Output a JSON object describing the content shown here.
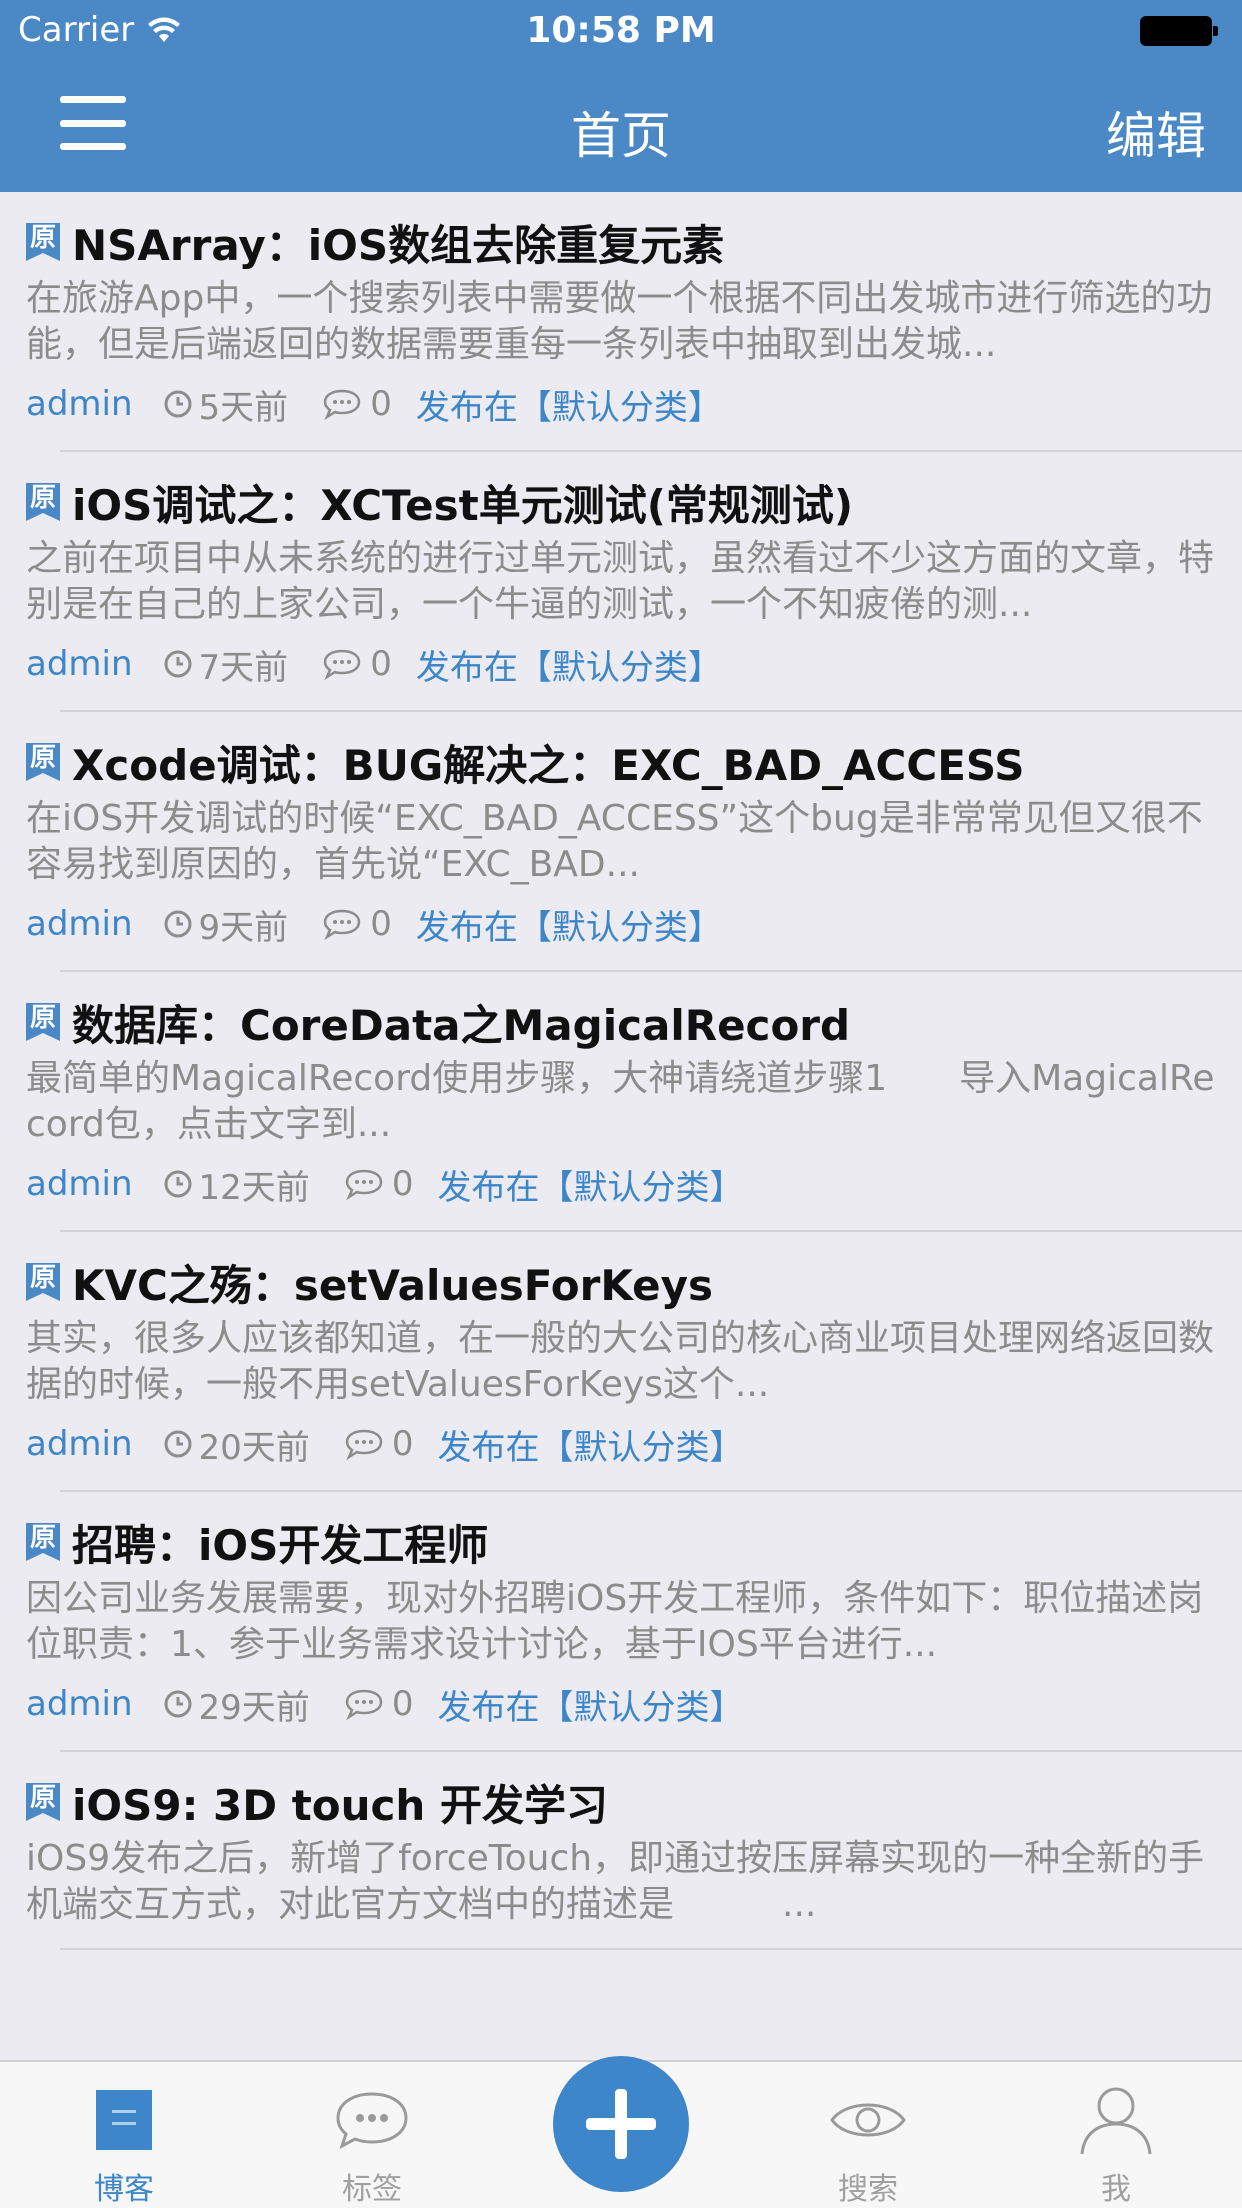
{
  "status_bar": {
    "carrier": "Carrier",
    "time": "10:58 PM"
  },
  "nav": {
    "title": "首页",
    "edit_label": "编辑"
  },
  "colors": {
    "nav_background": "#4a89c5",
    "accent": "#3d86c9",
    "background": "#ebebf1",
    "summary_text": "#8c8c8c"
  },
  "posts": [
    {
      "badge": "原",
      "title": "NSArray：iOS数组去除重复元素",
      "summary": "在旅游App中，一个搜索列表中需要做一个根据不同出发城市进行筛选的功能，但是后端返回的数据需要重每一条列表中抽取到出发城...",
      "author": "admin",
      "time": "5天前",
      "comments": "0",
      "category": "发布在【默认分类】"
    },
    {
      "badge": "原",
      "title": "iOS调试之：XCTest单元测试(常规测试)",
      "summary": "之前在项目中从未系统的进行过单元测试，虽然看过不少这方面的文章，特别是在自己的上家公司，一个牛逼的测试，一个不知疲倦的测...",
      "author": "admin",
      "time": "7天前",
      "comments": "0",
      "category": "发布在【默认分类】"
    },
    {
      "badge": "原",
      "title": "Xcode调试：BUG解决之：EXC_BAD_ACCESS",
      "summary": "在iOS开发调试的时候“EXC_BAD_ACCESS”这个bug是非常常见但又很不容易找到原因的，首先说“EXC_BAD...",
      "author": "admin",
      "time": "9天前",
      "comments": "0",
      "category": "发布在【默认分类】"
    },
    {
      "badge": "原",
      "title": "数据库：CoreData之MagicalRecord",
      "summary": "最简单的MagicalRecord使用步骤，大神请绕道步骤1　　导入MagicalRecord包，点击文字到...",
      "author": "admin",
      "time": "12天前",
      "comments": "0",
      "category": "发布在【默认分类】"
    },
    {
      "badge": "原",
      "title": "KVC之殇：setValuesForKeys",
      "summary": "其实，很多人应该都知道，在一般的大公司的核心商业项目处理网络返回数据的时候，一般不用setValuesForKeys这个...",
      "author": "admin",
      "time": "20天前",
      "comments": "0",
      "category": "发布在【默认分类】"
    },
    {
      "badge": "原",
      "title": "招聘：iOS开发工程师",
      "summary": "因公司业务发展需要，现对外招聘iOS开发工程师，条件如下：职位描述岗位职责：1、参于业务需求设计讨论，基于IOS平台进行...",
      "author": "admin",
      "time": "29天前",
      "comments": "0",
      "category": "发布在【默认分类】"
    },
    {
      "badge": "原",
      "title": "iOS9: 3D touch 开发学习",
      "summary": "iOS9发布之后，新增了forceTouch，即通过按压屏幕实现的一种全新的手机端交互方式，对此官方文档中的描述是　　　...",
      "author": "",
      "time": "",
      "comments": "",
      "category": ""
    }
  ],
  "tabbar": {
    "tabs": [
      {
        "label": "博客",
        "icon": "blog-icon",
        "active": true
      },
      {
        "label": "标签",
        "icon": "tag-chat-icon",
        "active": false
      },
      {
        "label": "",
        "icon": "plus-icon",
        "active": false
      },
      {
        "label": "搜索",
        "icon": "eye-icon",
        "active": false
      },
      {
        "label": "我",
        "icon": "profile-icon",
        "active": false
      }
    ]
  }
}
